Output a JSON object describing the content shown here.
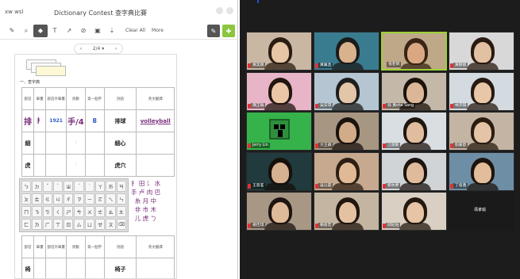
{
  "app": {
    "brand_label": "xw wsl",
    "window_title": "Dictionary Contest 查字典比賽"
  },
  "toolbar": {
    "tools": [
      {
        "icon": "pencil-icon",
        "glyph": "✎"
      },
      {
        "icon": "magnifier-icon",
        "glyph": "⌕"
      },
      {
        "icon": "eraser-icon",
        "glyph": "◆"
      },
      {
        "icon": "text-icon",
        "glyph": "T"
      },
      {
        "icon": "line-icon",
        "glyph": "↗"
      },
      {
        "icon": "link-icon",
        "glyph": "⊘"
      },
      {
        "icon": "image-icon",
        "glyph": "▣"
      },
      {
        "icon": "download-icon",
        "glyph": "⇣"
      }
    ],
    "clear_all_label": "Clear All",
    "more_label": "More",
    "right_buttons": [
      {
        "icon": "pen-tool-icon",
        "glyph": "✎",
        "color": "#555555"
      },
      {
        "icon": "add-page-icon",
        "glyph": "✚",
        "color": "#8cc63f"
      }
    ]
  },
  "pager": {
    "prev": "‹",
    "page_label": "2/4 ▾",
    "next": "›"
  },
  "worksheet": {
    "section_heading": "一、查字典",
    "header_cols": [
      "部首",
      "筆畫",
      "部首外筆畫",
      "頁數",
      "第一個字",
      "詞語",
      "英文翻譯"
    ],
    "row1": {
      "char": "排",
      "radical": "扌",
      "strokes": "8",
      "page": "1921",
      "first_word": "手/4",
      "extra": "8",
      "word": "排球",
      "english": "volleyball"
    },
    "row2": {
      "char": "細",
      "word": "細心"
    },
    "row3": {
      "char": "虎",
      "word": "虎穴"
    },
    "row4_char": "椅",
    "row4_word": "椅子"
  },
  "keyboard": {
    "rows": [
      [
        "ㄅ",
        "ㄉ",
        "ˇ",
        "ˋ",
        "ㄓ",
        "ˊ",
        "˙",
        "ㄚ",
        "ㄞ",
        "ㄢ"
      ],
      [
        "ㄆ",
        "ㄊ",
        "ㄍ",
        "ㄐ",
        "ㄔ",
        "ㄗ",
        "ㄧ",
        "ㄛ",
        "ㄟ",
        "ㄣ"
      ],
      [
        "ㄇ",
        "ㄋ",
        "ㄎ",
        "ㄑ",
        "ㄕ",
        "ㄘ",
        "ㄨ",
        "ㄜ",
        "ㄠ",
        "ㄤ"
      ],
      [
        "ㄈ",
        "ㄌ",
        "ㄏ",
        "ㄒ",
        "ㄖ",
        "ㄙ",
        "ㄩ",
        "ㄝ",
        "ㄡ",
        "⌫"
      ]
    ]
  },
  "radicals_panel": "扌 田 氵 水\n手 卢 肉 巴\n  糸 月 中\n  非 市 木\n  儿 虎 ㄅ",
  "gallery": {
    "tiles": [
      {
        "name": "黃奕穎",
        "bg": "#c9b7a4",
        "skin": "#e7c6a6",
        "hair": "#2c1d12",
        "mic": true
      },
      {
        "name": "黃翼丞",
        "bg": "#3a7c8f",
        "skin": "#d7b28c",
        "hair": "#1b1b1b",
        "mic": true
      },
      {
        "name": "張老師",
        "bg": "#bfa887",
        "skin": "#d9a883",
        "hair": "#3a2414",
        "mic": false,
        "speaking": true
      },
      {
        "name": "黃顯宸",
        "bg": "#d8d8d8",
        "skin": "#e2c1a3",
        "hair": "#2a1a0f",
        "mic": true
      },
      {
        "name": "陳芷瑜",
        "bg": "#e7b5c7",
        "skin": "#ebc7a8",
        "hair": "#23160f",
        "mic": true
      },
      {
        "name": "吳安琪",
        "bg": "#b5c6d2",
        "skin": "#e3c5a8",
        "hair": "#1e1e1e",
        "mic": true
      },
      {
        "name": "翁 黃sha Sang",
        "bg": "#c4b9a9",
        "skin": "#dcb797",
        "hair": "#1c120b",
        "mic": true
      },
      {
        "name": "林沛揚",
        "bg": "#d4dbe0",
        "skin": "#e8c7a8",
        "hair": "#261a12",
        "mic": true
      },
      {
        "name": "Jerry Lin",
        "bg": "#35b34a",
        "skin": "#000000",
        "hair": "#000000",
        "mic": true
      },
      {
        "name": "大王鋒",
        "bg": "#a79682",
        "skin": "#d2ab88",
        "hair": "#1a120c",
        "mic": true
      },
      {
        "name": "江俊毅",
        "bg": "#d9dee2",
        "skin": "#e0bd9e",
        "hair": "#1f1610",
        "mic": true
      },
      {
        "name": "劉嘉歆",
        "bg": "#c3b4a3",
        "skin": "#e4c4a6",
        "hair": "#2b1c12",
        "mic": true
      },
      {
        "name": "王思茗",
        "bg": "#203a3d",
        "skin": "#d6b291",
        "hair": "#16100b",
        "mic": true
      },
      {
        "name": "吳以晨",
        "bg": "#c6a98e",
        "skin": "#e0b995",
        "hair": "#2e1f14",
        "mic": true
      },
      {
        "name": "蔡依夢",
        "bg": "#d0d4d6",
        "skin": "#dfbb9c",
        "hair": "#1c1410",
        "mic": true
      },
      {
        "name": "丁俊鑫",
        "bg": "#6e8ea6",
        "skin": "#e2bd9b",
        "hair": "#1d140d",
        "mic": true
      },
      {
        "name": "楊佳琪",
        "bg": "#a99786",
        "skin": "#dfba98",
        "hair": "#1e1510",
        "mic": true
      },
      {
        "name": "賴俊宏",
        "bg": "#c3b5a1",
        "skin": "#e3c1a1",
        "hair": "#20160f",
        "mic": true
      },
      {
        "name": "邱紀佑",
        "bg": "#d9cfc3",
        "skin": "#e6c4a5",
        "hair": "#25190f",
        "mic": true
      },
      {
        "name": "馮孝瑜",
        "empty": true
      }
    ]
  }
}
